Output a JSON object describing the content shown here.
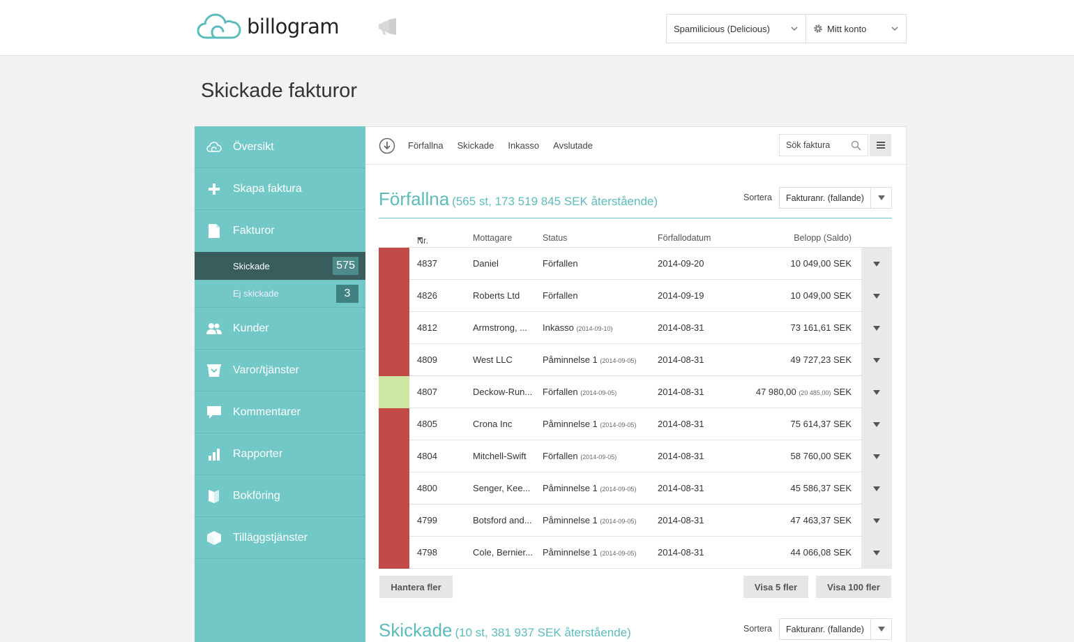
{
  "header": {
    "logo_text": "billogram",
    "company_select": "Spamilicious (Delicious)",
    "account_menu": "Mitt konto"
  },
  "page_title": "Skickade fakturor",
  "sidebar": {
    "items": [
      {
        "label": "Översikt",
        "icon": "cloud-icon"
      },
      {
        "label": "Skapa faktura",
        "icon": "plus-icon"
      },
      {
        "label": "Fakturor",
        "icon": "document-icon"
      }
    ],
    "subitems": [
      {
        "label": "Skickade",
        "count": "575"
      },
      {
        "label": "Ej skickade",
        "count": "3"
      }
    ],
    "items2": [
      {
        "label": "Kunder",
        "icon": "users-icon"
      },
      {
        "label": "Varor/tjänster",
        "icon": "basket-icon"
      },
      {
        "label": "Kommentarer",
        "icon": "speech-bubble-icon"
      },
      {
        "label": "Rapporter",
        "icon": "bar-chart-icon"
      },
      {
        "label": "Bokföring",
        "icon": "book-icon"
      },
      {
        "label": "Tilläggstjänster",
        "icon": "cube-icon"
      }
    ]
  },
  "filters": {
    "links": [
      "Förfallna",
      "Skickade",
      "Inkasso",
      "Avslutade"
    ],
    "search_placeholder": "Sök faktura"
  },
  "section1": {
    "title": "Förfallna",
    "subtitle": "(565 st, 173 519 845 SEK återstående)",
    "sort_label": "Sortera",
    "sort_value": "Fakturanr. (fallande)"
  },
  "columns": {
    "nr": "Nr.",
    "recipient": "Mottagare",
    "status": "Status",
    "due": "Förfallodatum",
    "amount": "Belopp (Saldo)"
  },
  "colors": {
    "overdue": "#c24b48",
    "partial": "#cde8a3",
    "accent": "#72c8c7"
  },
  "rows": [
    {
      "nr": "4837",
      "recipient": "Daniel",
      "status": "Förfallen",
      "status_date": "",
      "due": "2014-09-20",
      "amount": "10 049,00",
      "saldo": "",
      "currency": "SEK",
      "flag": "overdue"
    },
    {
      "nr": "4826",
      "recipient": "Roberts Ltd",
      "status": "Förfallen",
      "status_date": "",
      "due": "2014-09-19",
      "amount": "10 049,00",
      "saldo": "",
      "currency": "SEK",
      "flag": "overdue"
    },
    {
      "nr": "4812",
      "recipient": "Armstrong, ...",
      "status": "Inkasso",
      "status_date": "(2014-09-10)",
      "due": "2014-08-31",
      "amount": "73 161,61",
      "saldo": "",
      "currency": "SEK",
      "flag": "overdue"
    },
    {
      "nr": "4809",
      "recipient": "West LLC",
      "status": "Påminnelse 1",
      "status_date": "(2014-09-05)",
      "due": "2014-08-31",
      "amount": "49 727,23",
      "saldo": "",
      "currency": "SEK",
      "flag": "overdue"
    },
    {
      "nr": "4807",
      "recipient": "Deckow-Run...",
      "status": "Förfallen",
      "status_date": "(2014-09-05)",
      "due": "2014-08-31",
      "amount": "47 980,00",
      "saldo": "(20 485,00)",
      "currency": "SEK",
      "flag": "partial"
    },
    {
      "nr": "4805",
      "recipient": "Crona Inc",
      "status": "Påminnelse 1",
      "status_date": "(2014-09-05)",
      "due": "2014-08-31",
      "amount": "75 614,37",
      "saldo": "",
      "currency": "SEK",
      "flag": "overdue"
    },
    {
      "nr": "4804",
      "recipient": "Mitchell-Swift",
      "status": "Förfallen",
      "status_date": "(2014-09-05)",
      "due": "2014-08-31",
      "amount": "58 760,00",
      "saldo": "",
      "currency": "SEK",
      "flag": "overdue"
    },
    {
      "nr": "4800",
      "recipient": "Senger, Kee...",
      "status": "Påminnelse 1",
      "status_date": "(2014-09-05)",
      "due": "2014-08-31",
      "amount": "45 586,37",
      "saldo": "",
      "currency": "SEK",
      "flag": "overdue"
    },
    {
      "nr": "4799",
      "recipient": "Botsford and...",
      "status": "Påminnelse 1",
      "status_date": "(2014-09-05)",
      "due": "2014-08-31",
      "amount": "47 463,37",
      "saldo": "",
      "currency": "SEK",
      "flag": "overdue"
    },
    {
      "nr": "4798",
      "recipient": "Cole, Bernier...",
      "status": "Påminnelse 1",
      "status_date": "(2014-09-05)",
      "due": "2014-08-31",
      "amount": "44 066,08",
      "saldo": "",
      "currency": "SEK",
      "flag": "overdue"
    }
  ],
  "buttons": {
    "manage_more": "Hantera fler",
    "show_5": "Visa 5 fler",
    "show_100": "Visa 100 fler"
  },
  "section2": {
    "title": "Skickade",
    "subtitle": "(10 st, 381 937 SEK återstående)",
    "sort_label": "Sortera",
    "sort_value": "Fakturanr. (fallande)"
  }
}
